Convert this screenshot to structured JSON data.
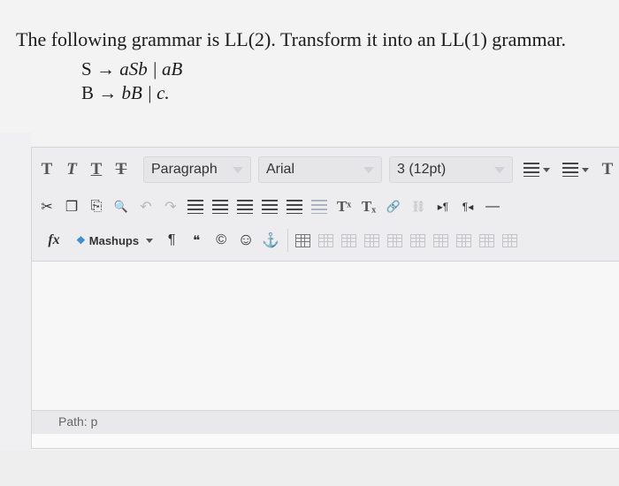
{
  "question": {
    "text": "The following grammar is LL(2). Transform it into an LL(1) grammar.",
    "production1": {
      "lhs": "S",
      "arrow": "→",
      "rhs": "aSb | aB"
    },
    "production2": {
      "lhs": "B",
      "arrow": "→",
      "rhs": "bB | c."
    }
  },
  "toolbar": {
    "row1": {
      "bold": "T",
      "italic": "T",
      "underline": "T",
      "strike": "T",
      "paragraph": "Paragraph",
      "font": "Arial",
      "size": "3 (12pt)",
      "extra": "T"
    },
    "row2": {
      "cut": "✂",
      "copy": "❐",
      "paste": "⎘",
      "find": "🔍",
      "undo": "↶",
      "redo": "↷",
      "superscript": "Tˣ",
      "subscript": "Tₓ",
      "link": "🔗",
      "unlink": "⛓",
      "ltr": "▸¶",
      "rtl": "¶◂",
      "hr": "—"
    },
    "row3": {
      "formula": "fx",
      "mashups": "Mashups",
      "pilcrow": "¶",
      "quote": "❝",
      "copyright": "©",
      "emoji": "☺",
      "anchor": "⚓"
    }
  },
  "editor": {
    "content": "",
    "path_label": "Path: p"
  },
  "colors": {
    "toolbar_bg": "#ededef",
    "page_bg": "#f3f3f4",
    "accent": "#3a8fd6"
  }
}
